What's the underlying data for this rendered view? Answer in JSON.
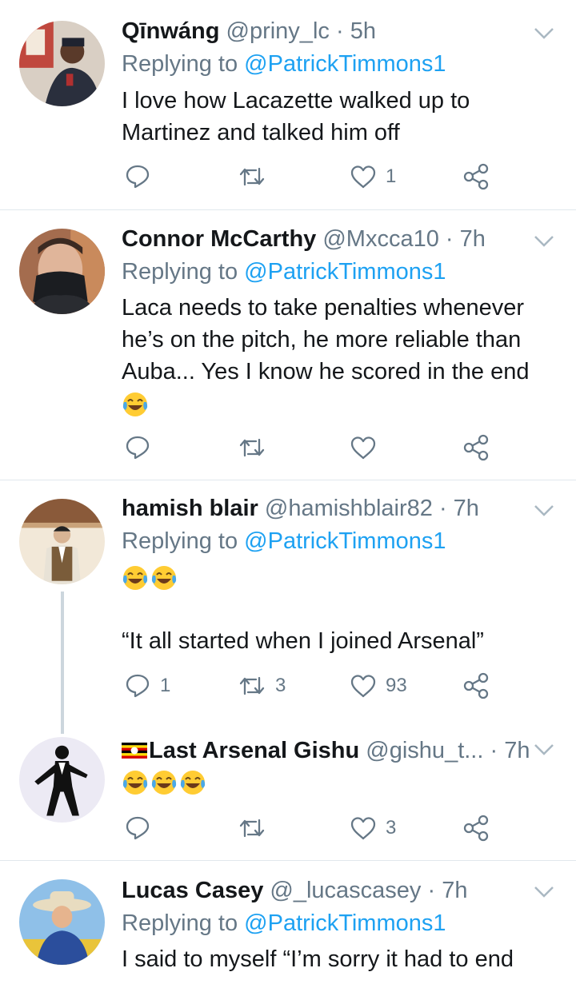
{
  "tweets": [
    {
      "name": "Qīnwáng",
      "handle": "@priny_lc",
      "time": "5h",
      "replying_to_label": "Replying to",
      "replying_to": "@PatrickTimmons1",
      "text_lines": [
        "I love how Lacazette walked up to",
        "Martinez and talked him off"
      ],
      "reply_count": "",
      "retweet_count": "",
      "like_count": "1"
    },
    {
      "name": "Connor McCarthy",
      "handle": "@Mxcca10",
      "time": "7h",
      "replying_to_label": "Replying to",
      "replying_to": "@PatrickTimmons1",
      "text_lines": [
        "Laca needs to take penalties whenever",
        "he’s on the pitch, he more reliable than",
        "Auba... Yes I know he scored in the end"
      ],
      "reply_count": "",
      "retweet_count": "",
      "like_count": ""
    },
    {
      "name": "hamish blair",
      "handle": "@hamishblair82",
      "time": "7h",
      "replying_to_label": "Replying to",
      "replying_to": "@PatrickTimmons1",
      "text_lines": [
        "“It all started when I joined Arsenal”"
      ],
      "reply_count": "1",
      "retweet_count": "3",
      "like_count": "93"
    },
    {
      "name": "Last Arsenal Gishu",
      "handle": "@gishu_t...",
      "time": "7h",
      "reply_count": "",
      "retweet_count": "",
      "like_count": "3"
    },
    {
      "name": "Lucas Casey",
      "handle": "@_lucascasey",
      "time": "7h",
      "replying_to_label": "Replying to",
      "replying_to": "@PatrickTimmons1",
      "text_lines": [
        "I said to myself “I’m sorry it had to end"
      ]
    }
  ],
  "separator": "·",
  "colors": {
    "accent": "#1da1f2",
    "muted": "#657786",
    "text": "#14171a",
    "divider": "#e1e8ed"
  },
  "icons": [
    "reply-icon",
    "retweet-icon",
    "like-icon",
    "share-icon",
    "chevron-down-icon",
    "laughing-tears-emoji",
    "uganda-flag-icon"
  ]
}
